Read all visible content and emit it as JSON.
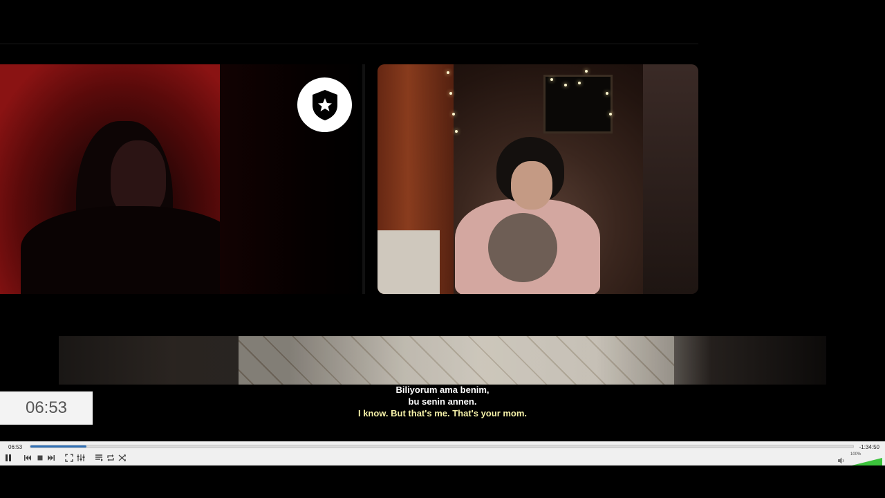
{
  "subtitles": {
    "line1": "Biliyorum ama benim,",
    "line2": "bu senin annen.",
    "line3": "I know. But that's me. That's your mom."
  },
  "clock_overlay": "06:53",
  "player": {
    "elapsed": "06:53",
    "remaining": "-1:34:50",
    "progress_fraction": 0.068,
    "volume_label": "100%",
    "volume_fraction": 1.0,
    "icons": [
      "pause-icon",
      "previous-icon",
      "stop-icon",
      "next-icon",
      "fullscreen-icon",
      "extended-settings-icon",
      "playlist-icon",
      "loop-icon",
      "shuffle-icon",
      "volume-icon"
    ]
  },
  "colors": {
    "seek_fill": "#2e6fb5",
    "volume_fill": "#3cc43c",
    "subtitle_primary": "#ffffff",
    "subtitle_secondary": "#f4f0a8"
  }
}
